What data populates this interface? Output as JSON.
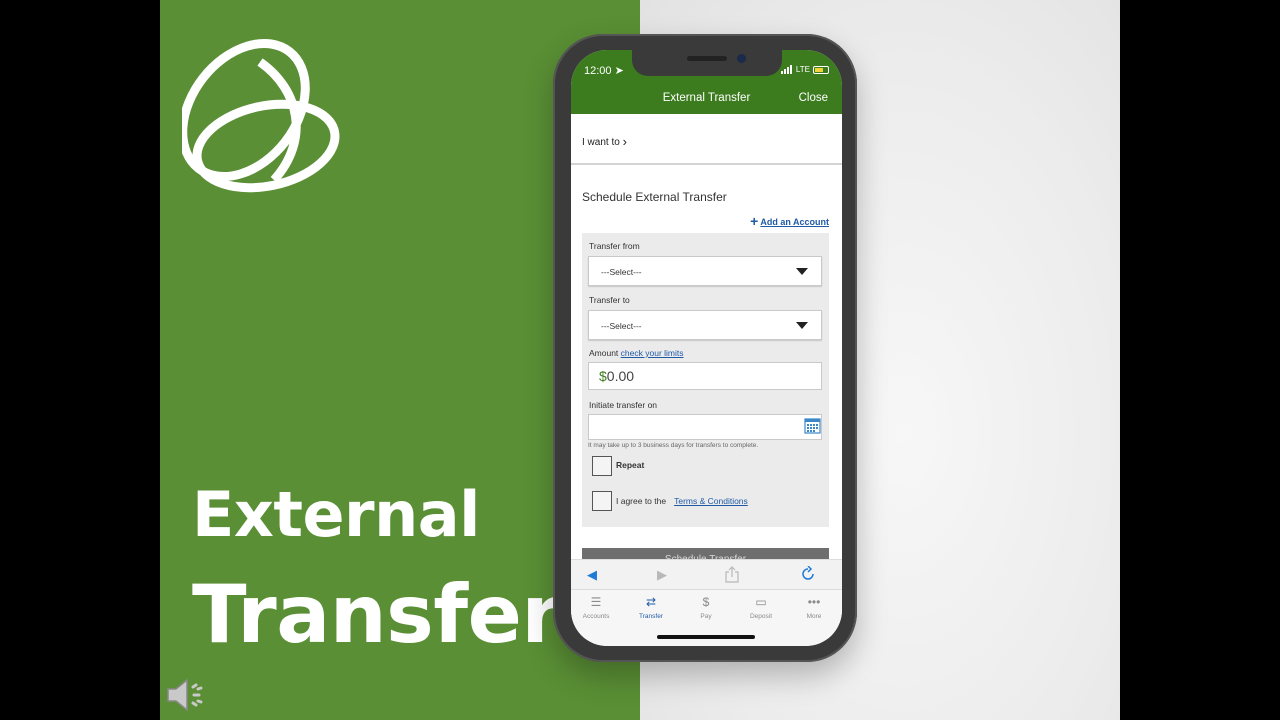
{
  "slide": {
    "title_line1": "External",
    "title_line2": "Transfers",
    "colors": {
      "green": "#5a8f35",
      "app_green": "#3c7c1e",
      "link_blue": "#1f5aa6"
    }
  },
  "status_bar": {
    "time": "12:00",
    "network": "LTE"
  },
  "app_header": {
    "title": "External Transfer",
    "close_label": "Close"
  },
  "want_row": {
    "label": "I want to"
  },
  "form": {
    "section_title": "Schedule External Transfer",
    "add_account_label": "Add an Account",
    "transfer_from_label": "Transfer from",
    "transfer_from_value": "---Select---",
    "transfer_to_label": "Transfer to",
    "transfer_to_value": "---Select---",
    "amount_label": "Amount",
    "limits_link": "check your limits",
    "amount_currency": "$",
    "amount_value": "0.00",
    "initiate_label": "Initiate transfer on",
    "date_value": "",
    "date_hint": "It may take up to 3 business days for transfers to complete.",
    "repeat_label": "Repeat",
    "agree_label": "I agree to the",
    "terms_link": "Terms & Conditions",
    "submit_label": "Schedule Transfer"
  },
  "browser_bar": {
    "back_icon": "back-arrow-icon",
    "forward_icon": "forward-arrow-icon",
    "share_icon": "share-icon",
    "reload_icon": "reload-icon"
  },
  "tab_bar": {
    "tabs": [
      {
        "label": "Accounts",
        "icon": "menu-icon"
      },
      {
        "label": "Transfer",
        "icon": "transfer-icon"
      },
      {
        "label": "Pay",
        "icon": "pay-icon"
      },
      {
        "label": "Deposit",
        "icon": "deposit-icon"
      },
      {
        "label": "More",
        "icon": "more-icon"
      }
    ],
    "active": "Transfer"
  }
}
